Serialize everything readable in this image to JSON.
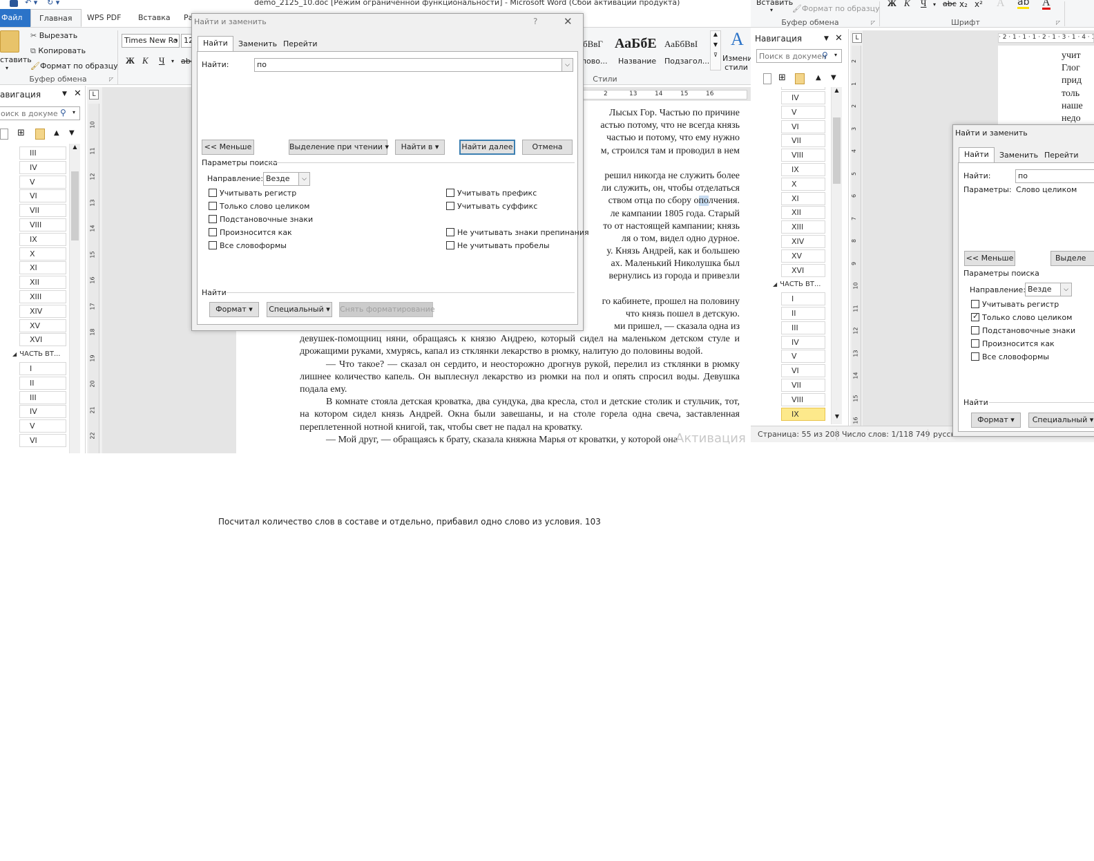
{
  "window": {
    "title": "demo_2125_10.doc [Режим ограниченной функциональности] - Microsoft Word (Сбой активации продукта)"
  },
  "ribbon_tabs": [
    "Файл",
    "Главная",
    "WPS PDF",
    "Вставка",
    "Ра"
  ],
  "clipboard": {
    "paste": "ставить",
    "cut": "Вырезать",
    "copy": "Копировать",
    "format_painter": "Формат по образцу",
    "group_label": "Буфер обмена"
  },
  "font": {
    "name": "Times New Ro",
    "size": "12",
    "bold": "Ж",
    "italic": "К",
    "underline": "Ч",
    "strike": "abe"
  },
  "styles": {
    "items": [
      {
        "preview": "бВвГ",
        "label": "лово..."
      },
      {
        "preview": "АаБбЕ",
        "label": "Название"
      },
      {
        "preview": "АаБбВвI",
        "label": "Подзагол..."
      }
    ],
    "change": "Изменить стили",
    "group_label": "Стили"
  },
  "nav_left": {
    "title": "авигация",
    "search_placeholder": "оиск в докуме",
    "items": [
      "III",
      "IV",
      "V",
      "VI",
      "VII",
      "VIII",
      "IX",
      "X",
      "XI",
      "XII",
      "XIII",
      "XIV",
      "XV",
      "XVI"
    ],
    "part": "ЧАСТЬ ВТ...",
    "items2": [
      "I",
      "II",
      "III",
      "IV",
      "V",
      "VI"
    ]
  },
  "ruler_h": [
    "1",
    "2",
    "13",
    "14",
    "15",
    "16"
  ],
  "ruler_v": [
    "10",
    "11",
    "12",
    "13",
    "14",
    "15",
    "16",
    "17",
    "18",
    "19",
    "20",
    "21",
    "22"
  ],
  "doc_partial_lines": [
    "Лысых Гор. Частью по причине",
    "астью потому, что не всегда князь",
    "частью и потому, что ему нужно",
    "м, строился там и проводил в нем",
    "",
    "решил никогда не служить более",
    "ли служить, он, чтобы отделаться",
    "ством отца по сбору ",
    "ле кампании 1805 года. Старый",
    "то от настоящей кампании; князь",
    "ля о том, видел одно дурное.",
    "у. Князь Андрей, как и большею",
    "ах. Маленький Николушка был",
    "вернулись из города и привезли",
    "",
    "го кабинете, прошел на половину",
    "что князь пошел в детскую."
  ],
  "doc_highlight": {
    "before": "о",
    "hit": "по",
    "after": "лчения."
  },
  "doc_full": [
    "ми пришел, — сказала одна из",
    "девушек-помощниц няни, обращаясь к князю Андрею, который сидел на маленьком детском стуле и дрожащими руками, хмурясь, капал из стклянки лекарство в рюмку, налитую до половины водой.",
    "— Что такое? — сказал он сердито, и неосторожно дрогнув рукой, перелил из стклянки в рюмку лишнее количество капель. Он выплеснул лекарство из рюмки на пол и опять спросил воды. Девушка подала ему.",
    "В комнате стояла детская кроватка, два сундука, два кресла, стол и детские столик и стульчик, тот, на котором сидел князь Андрей. Окна были завешаны, и на столе горела одна свеча, заставленная переплетенной нотной книгой, так, чтобы свет не падал на кроватку.",
    "— Мой друг, — обращаясь к брату, сказала княжна Марья от кроватки, у которой она"
  ],
  "watermark": "Активация",
  "dialog1": {
    "title": "Найти и заменить",
    "help": "?",
    "tabs": [
      "Найти",
      "Заменить",
      "Перейти"
    ],
    "find_label": "Найти:",
    "find_value": "по",
    "btn_less": "<< Меньше",
    "btn_highlight": "Выделение при чтении ▾",
    "btn_find_in": "Найти в ▾",
    "btn_find_next": "Найти далее",
    "btn_cancel": "Отмена",
    "params_label": "Параметры поиска",
    "direction_label": "Направление:",
    "direction_value": "Везде",
    "opts_left": [
      {
        "label": "Учитывать регистр",
        "checked": false
      },
      {
        "label": "Только слово целиком",
        "checked": false
      },
      {
        "label": "Подстановочные знаки",
        "checked": false
      },
      {
        "label": "Произносится как",
        "checked": false
      },
      {
        "label": "Все словоформы",
        "checked": false
      }
    ],
    "opts_right": [
      {
        "label": "Учитывать префикс",
        "checked": false
      },
      {
        "label": "Учитывать суффикс",
        "checked": false
      },
      {
        "label": "Не учитывать знаки препинания",
        "checked": false
      },
      {
        "label": "Не учитывать пробелы",
        "checked": false
      }
    ],
    "find_section": "Найти",
    "btn_format": "Формат ▾",
    "btn_special": "Специальный ▾",
    "btn_clear": "Снять форматирование"
  },
  "win2": {
    "paste": "Вставить",
    "format_painter": "Формат по образцу",
    "clipboard_label": "Буфер обмена",
    "font_label": "Шрифт",
    "font_buttons": [
      "Ж",
      "К",
      "Ч",
      "abc",
      "x₂",
      "x²"
    ],
    "nav_title": "Навигация",
    "search_placeholder": "Поиск в докумен",
    "items": [
      "IV",
      "V",
      "VI",
      "VII",
      "VIII",
      "IX",
      "X",
      "XI",
      "XII",
      "XIII",
      "XIV",
      "XV",
      "XVI"
    ],
    "part": "ЧАСТЬ ВТ...",
    "items2": [
      "I",
      "II",
      "III",
      "IV",
      "V",
      "VI",
      "VII",
      "VIII",
      "IX"
    ],
    "ruler_v": [
      "2",
      "1",
      "2",
      "3",
      "4",
      "5",
      "6",
      "7",
      "8",
      "9",
      "10",
      "11",
      "12",
      "13",
      "14",
      "15",
      "16"
    ],
    "ruler_h": "· 2 · 1 · 1 · 1 · 2 · 1 · 3 · 1 · 4 · 1",
    "doc_lines": [
      "учит",
      "Глог",
      "прид",
      "толь",
      "наше",
      "недо"
    ],
    "status_page": "Страница: 55 из 208",
    "status_words": "Число слов: 1/118 749",
    "status_lang": "русск"
  },
  "dialog2": {
    "title": "Найти и заменить",
    "tabs": [
      "Найти",
      "Заменить",
      "Перейти"
    ],
    "find_label": "Найти:",
    "find_value": "по",
    "params_label": "Параметры:",
    "params_value": "Слово целиком",
    "btn_less": "<< Меньше",
    "btn_highlight": "Выделе",
    "search_params": "Параметры поиска",
    "direction_label": "Направление:",
    "direction_value": "Везде",
    "opts": [
      {
        "label": "Учитывать регистр",
        "checked": false
      },
      {
        "label": "Только слово целиком",
        "checked": true
      },
      {
        "label": "Подстановочные знаки",
        "checked": false
      },
      {
        "label": "Произносится как",
        "checked": false
      },
      {
        "label": "Все словоформы",
        "checked": false
      }
    ],
    "find_section": "Найти",
    "btn_format": "Формат ▾",
    "btn_special": "Специальный ▾"
  },
  "caption": "Посчитал количество слов в составе и отдельно, прибавил одно слово из условия. 103"
}
